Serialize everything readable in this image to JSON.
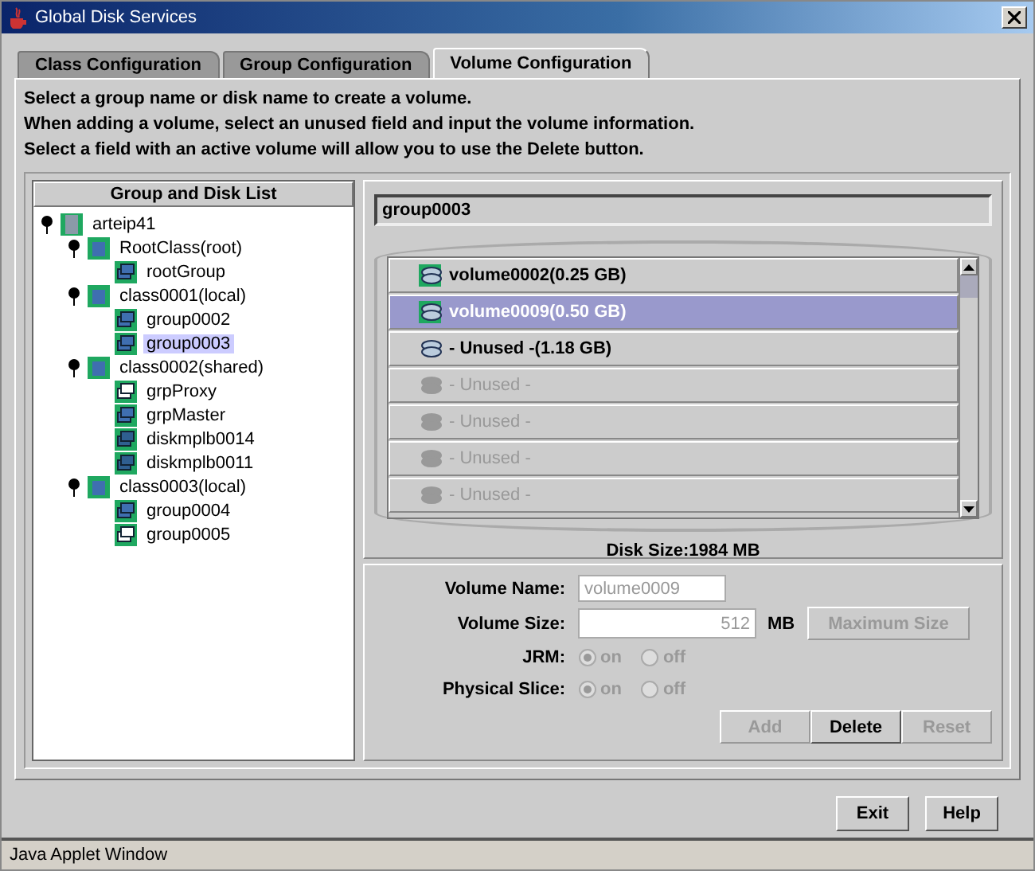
{
  "window": {
    "title": "Global Disk Services"
  },
  "tabs": [
    {
      "label": "Class Configuration",
      "selected": false
    },
    {
      "label": "Group Configuration",
      "selected": false
    },
    {
      "label": "Volume Configuration",
      "selected": true
    }
  ],
  "instructions": [
    "Select a group name or disk name to create a volume.",
    "When adding a volume, select an unused field and input the volume information.",
    "Select a field with an active volume will allow you to use the Delete button."
  ],
  "tree": {
    "header": "Group and Disk List",
    "nodes": [
      {
        "label": "arteip41",
        "kind": "server",
        "expanded": true,
        "selected": false,
        "children": [
          {
            "label": "RootClass(root)",
            "kind": "class",
            "expanded": true,
            "selected": false,
            "children": [
              {
                "label": "rootGroup",
                "kind": "group",
                "selected": false
              }
            ]
          },
          {
            "label": "class0001(local)",
            "kind": "class",
            "expanded": true,
            "selected": false,
            "children": [
              {
                "label": "group0002",
                "kind": "disk",
                "selected": false
              },
              {
                "label": "group0003",
                "kind": "group",
                "selected": true
              }
            ]
          },
          {
            "label": "class0002(shared)",
            "kind": "class",
            "expanded": true,
            "selected": false,
            "children": [
              {
                "label": "grpProxy",
                "kind": "proxy",
                "selected": false
              },
              {
                "label": "grpMaster",
                "kind": "group",
                "selected": false
              },
              {
                "label": "diskmplb0014",
                "kind": "mpdisk",
                "selected": false
              },
              {
                "label": "diskmplb0011",
                "kind": "mpdisk",
                "selected": false
              }
            ]
          },
          {
            "label": "class0003(local)",
            "kind": "class",
            "expanded": true,
            "selected": false,
            "children": [
              {
                "label": "group0004",
                "kind": "group",
                "selected": false
              },
              {
                "label": "group0005",
                "kind": "proxy",
                "selected": false
              }
            ]
          }
        ]
      }
    ]
  },
  "group_name": "group0003",
  "volumes": [
    {
      "label": "volume0002(0.25 GB)",
      "kind": "volume",
      "selected": false
    },
    {
      "label": "volume0009(0.50 GB)",
      "kind": "volume",
      "selected": true
    },
    {
      "label": "- Unused -(1.18 GB)",
      "kind": "unused",
      "selected": false
    },
    {
      "label": "- Unused -",
      "kind": "empty",
      "selected": false
    },
    {
      "label": "- Unused -",
      "kind": "empty",
      "selected": false
    },
    {
      "label": "- Unused -",
      "kind": "empty",
      "selected": false
    },
    {
      "label": "- Unused -",
      "kind": "empty",
      "selected": false
    }
  ],
  "disk_size": "Disk Size:1984 MB",
  "form": {
    "volume_name_label": "Volume Name:",
    "volume_name": "volume0009",
    "volume_size_label": "Volume Size:",
    "volume_size": "512",
    "unit": "MB",
    "max_button": {
      "label": "Maximum Size",
      "disabled": true
    },
    "radios": [
      {
        "label": "JRM:",
        "options": [
          {
            "label": "on",
            "selected": true
          },
          {
            "label": "off",
            "selected": false
          }
        ]
      },
      {
        "label": "Physical Slice:",
        "options": [
          {
            "label": "on",
            "selected": true
          },
          {
            "label": "off",
            "selected": false
          }
        ]
      }
    ],
    "buttons": [
      {
        "label": "Add",
        "disabled": true
      },
      {
        "label": "Delete",
        "disabled": false
      },
      {
        "label": "Reset",
        "disabled": true
      }
    ]
  },
  "footer_buttons": [
    "Exit",
    "Help"
  ],
  "status_bar": "Java Applet Window"
}
